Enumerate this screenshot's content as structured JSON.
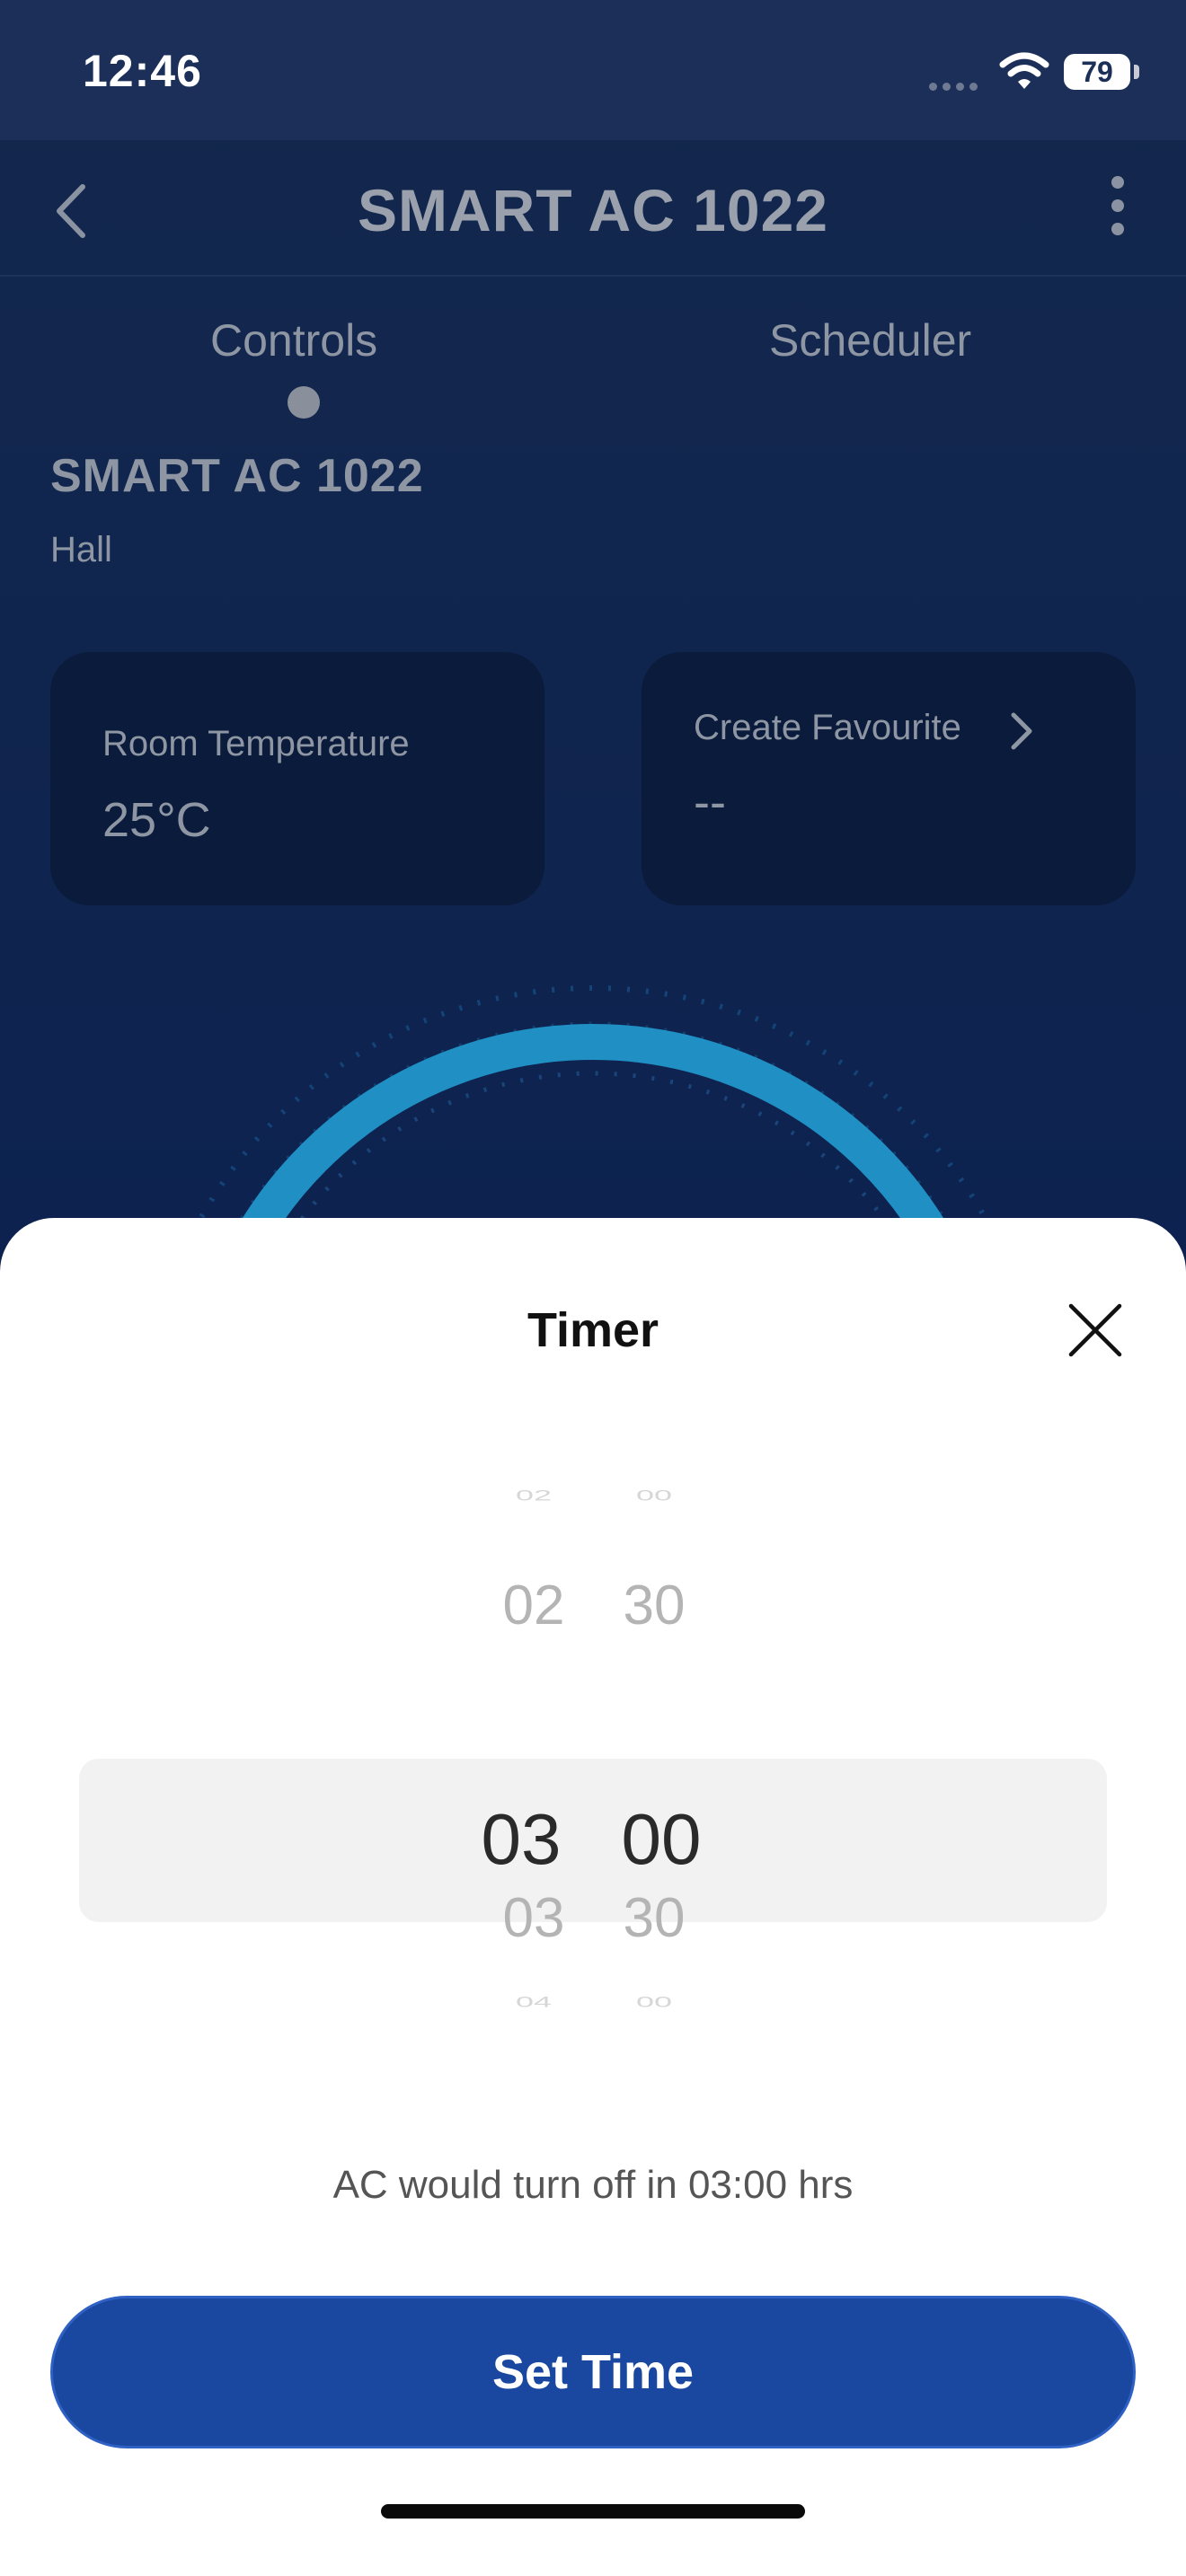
{
  "status_bar": {
    "time": "12:46",
    "battery": "79"
  },
  "header": {
    "title": "SMART AC 1022"
  },
  "tabs": [
    {
      "label": "Controls",
      "active": true
    },
    {
      "label": "Scheduler",
      "active": false
    }
  ],
  "device": {
    "name": "SMART AC 1022",
    "room": "Hall"
  },
  "cards": {
    "room_temperature": {
      "label": "Room Temperature",
      "value": "25°C"
    },
    "favourite": {
      "label": "Create Favourite",
      "value": "--"
    }
  },
  "timer_sheet": {
    "title": "Timer",
    "picker": {
      "hours": {
        "far_above": "02",
        "above": "02",
        "selected": "03",
        "below": "03",
        "far_below": "04"
      },
      "minutes": {
        "far_above": "00",
        "above": "30",
        "selected": "00",
        "below": "30",
        "far_below": "00"
      }
    },
    "summary": "AC would turn off in 03:00 hrs",
    "set_button_label": "Set Time"
  },
  "colors": {
    "primary_button": "#1a48a0",
    "background_top": "#14284d",
    "dial_arc": "#1f8fc4"
  }
}
